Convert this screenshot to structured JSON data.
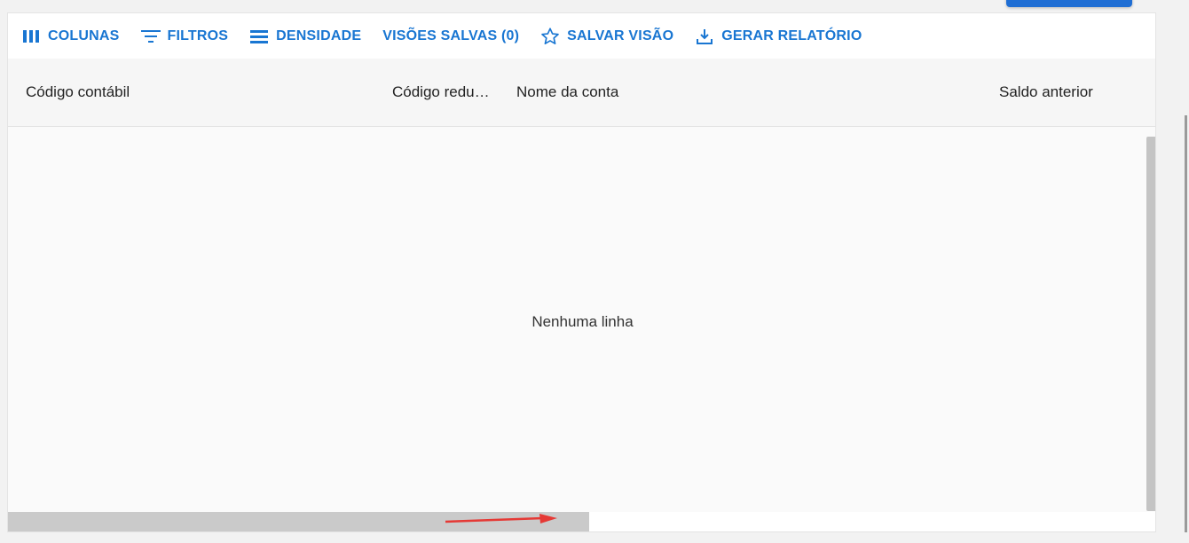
{
  "toolbar": {
    "columns_label": "COLUNAS",
    "filters_label": "FILTROS",
    "density_label": "DENSIDADE",
    "saved_views_label": "VISÕES SALVAS (0)",
    "save_view_label": "SALVAR VISÃO",
    "report_label": "GERAR RELATÓRIO"
  },
  "table": {
    "columns": [
      "Código contábil",
      "Código redu…",
      "Nome da conta",
      "Saldo anterior"
    ],
    "empty_message": "Nenhuma linha"
  },
  "colors": {
    "accent": "#1976d2",
    "header_bg": "#f6f6f6",
    "body_bg": "#fafafa",
    "arrow": "#e53935"
  },
  "icons": {
    "columns": "columns-icon",
    "filters": "filter-icon",
    "density": "density-icon",
    "save_view": "star-outline-icon",
    "report": "download-icon"
  }
}
